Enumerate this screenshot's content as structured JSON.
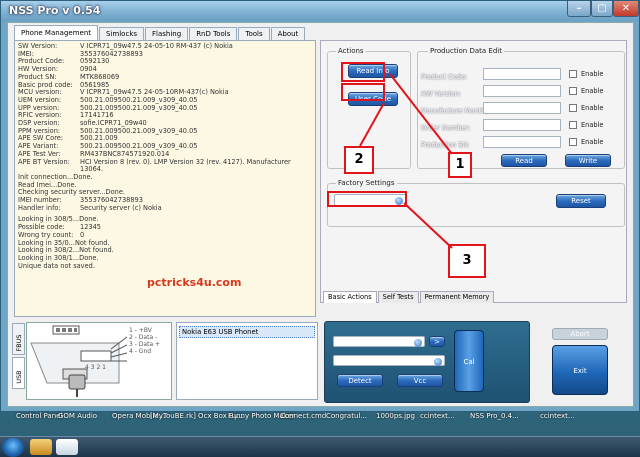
{
  "window": {
    "title": "NSS Pro v 0.54"
  },
  "top_tabs": [
    "Phone Management",
    "Simlocks",
    "Flashing",
    "RnD Tools",
    "Tools",
    "About"
  ],
  "info_rows": [
    {
      "k": "SW Version:",
      "v": "V ICPR71_09w47.5 24-05-10 RM-437 (c) Nokia"
    },
    {
      "k": "IMEI:",
      "v": "355376042738893"
    },
    {
      "k": "Product Code:",
      "v": "0592130"
    },
    {
      "k": "HW Version:",
      "v": "0904"
    },
    {
      "k": "Product SN:",
      "v": "MTK868069"
    },
    {
      "k": "Basic prod code:",
      "v": "0561985"
    },
    {
      "k": "MCU version:",
      "v": "V ICPR71_09w47.5 24-05-10RM-437(c) Nokia"
    },
    {
      "k": "UEM version:",
      "v": "500.21.009500.21.009_v309_40.05"
    },
    {
      "k": "UPP version:",
      "v": "500.21.009500.21.009_v309_40.05"
    },
    {
      "k": "RFIC version:",
      "v": "17141716"
    },
    {
      "k": "DSP version:",
      "v": "sofie.ICPR71_09w40"
    },
    {
      "k": "PPM version:",
      "v": "500.21.009500.21.009_v309_40.05"
    },
    {
      "k": "APE SW Core:",
      "v": "500.21.009"
    },
    {
      "k": "APE Variant:",
      "v": "500.21.009500.21.009_v309_40.05"
    },
    {
      "k": "APE Test Ver:",
      "v": "RM437BNC874571920.014"
    },
    {
      "k": "APE BT Version:",
      "v": "HCI Version 8 (rev. 0). LMP Version 32 (rev. 4127). Manufacturer 13064."
    }
  ],
  "log_block_1": [
    "Init connection...Done.",
    "Read Imei...Done.",
    "Checking security server...Done."
  ],
  "imei_row": {
    "k": "IMEI number:",
    "v": "355376042738893"
  },
  "handler_row": {
    "k": "Handler info:",
    "v": "Security server (c) Nokia"
  },
  "log_block_2": [
    {
      "k": "Looking in 308/5...Done.",
      "v": ""
    },
    {
      "k": "Possible code:",
      "v": "12345"
    },
    {
      "k": "Wrong try count:",
      "v": "0"
    },
    {
      "k": "Looking in 35/0...Not found.",
      "v": ""
    },
    {
      "k": "Looking in 308/2...Not found.",
      "v": ""
    },
    {
      "k": "Looking in 308/1...Done.",
      "v": ""
    },
    {
      "k": "Unique data not saved.",
      "v": ""
    }
  ],
  "watermark": "pctricks4u.com",
  "actions": {
    "title": "Actions",
    "read_info": "Read Info",
    "user_code": "User Code"
  },
  "production": {
    "title": "Production Data Edit",
    "fields": [
      "Product Code:",
      "HW Version:",
      "Manufacture Month:",
      "Order Number:",
      "Production SN:"
    ],
    "enable_label": "Enable",
    "read": "Read",
    "write": "Write"
  },
  "factory": {
    "title": "Factory Settings",
    "reset": "Reset"
  },
  "bottom_tabs": [
    "Basic Actions",
    "Self Tests",
    "Permanent Memory"
  ],
  "side_tabs": [
    "FBUS",
    "USB"
  ],
  "pins": [
    "1 - +BV",
    "2 - Data -",
    "3 - Data +",
    "4 - Gnd"
  ],
  "phone_list": [
    "Nokia E63 USB Phonet"
  ],
  "controls": {
    "arrow_button": ">",
    "detect": "Detect",
    "vcc": "Vcc",
    "cal": "Cal"
  },
  "abort": "Abort",
  "exit": "Exit",
  "annotations": [
    "1",
    "2",
    "3"
  ],
  "desktop_labels": [
    "Control Panel",
    "GOM Audio",
    "Opera Mobile...",
    "[MyTouBE.rk] Ocx Box By...",
    "Funny Photo Maker",
    "Connect.cmd",
    "Congratul...",
    "1000ps.jpg",
    "ccintext...",
    "NSS Pro_0.4...",
    "ccintext..."
  ],
  "colors": {
    "annotation": "#e0141a",
    "button_blue": "#2c6bbd",
    "watermark": "#d63a1e"
  }
}
